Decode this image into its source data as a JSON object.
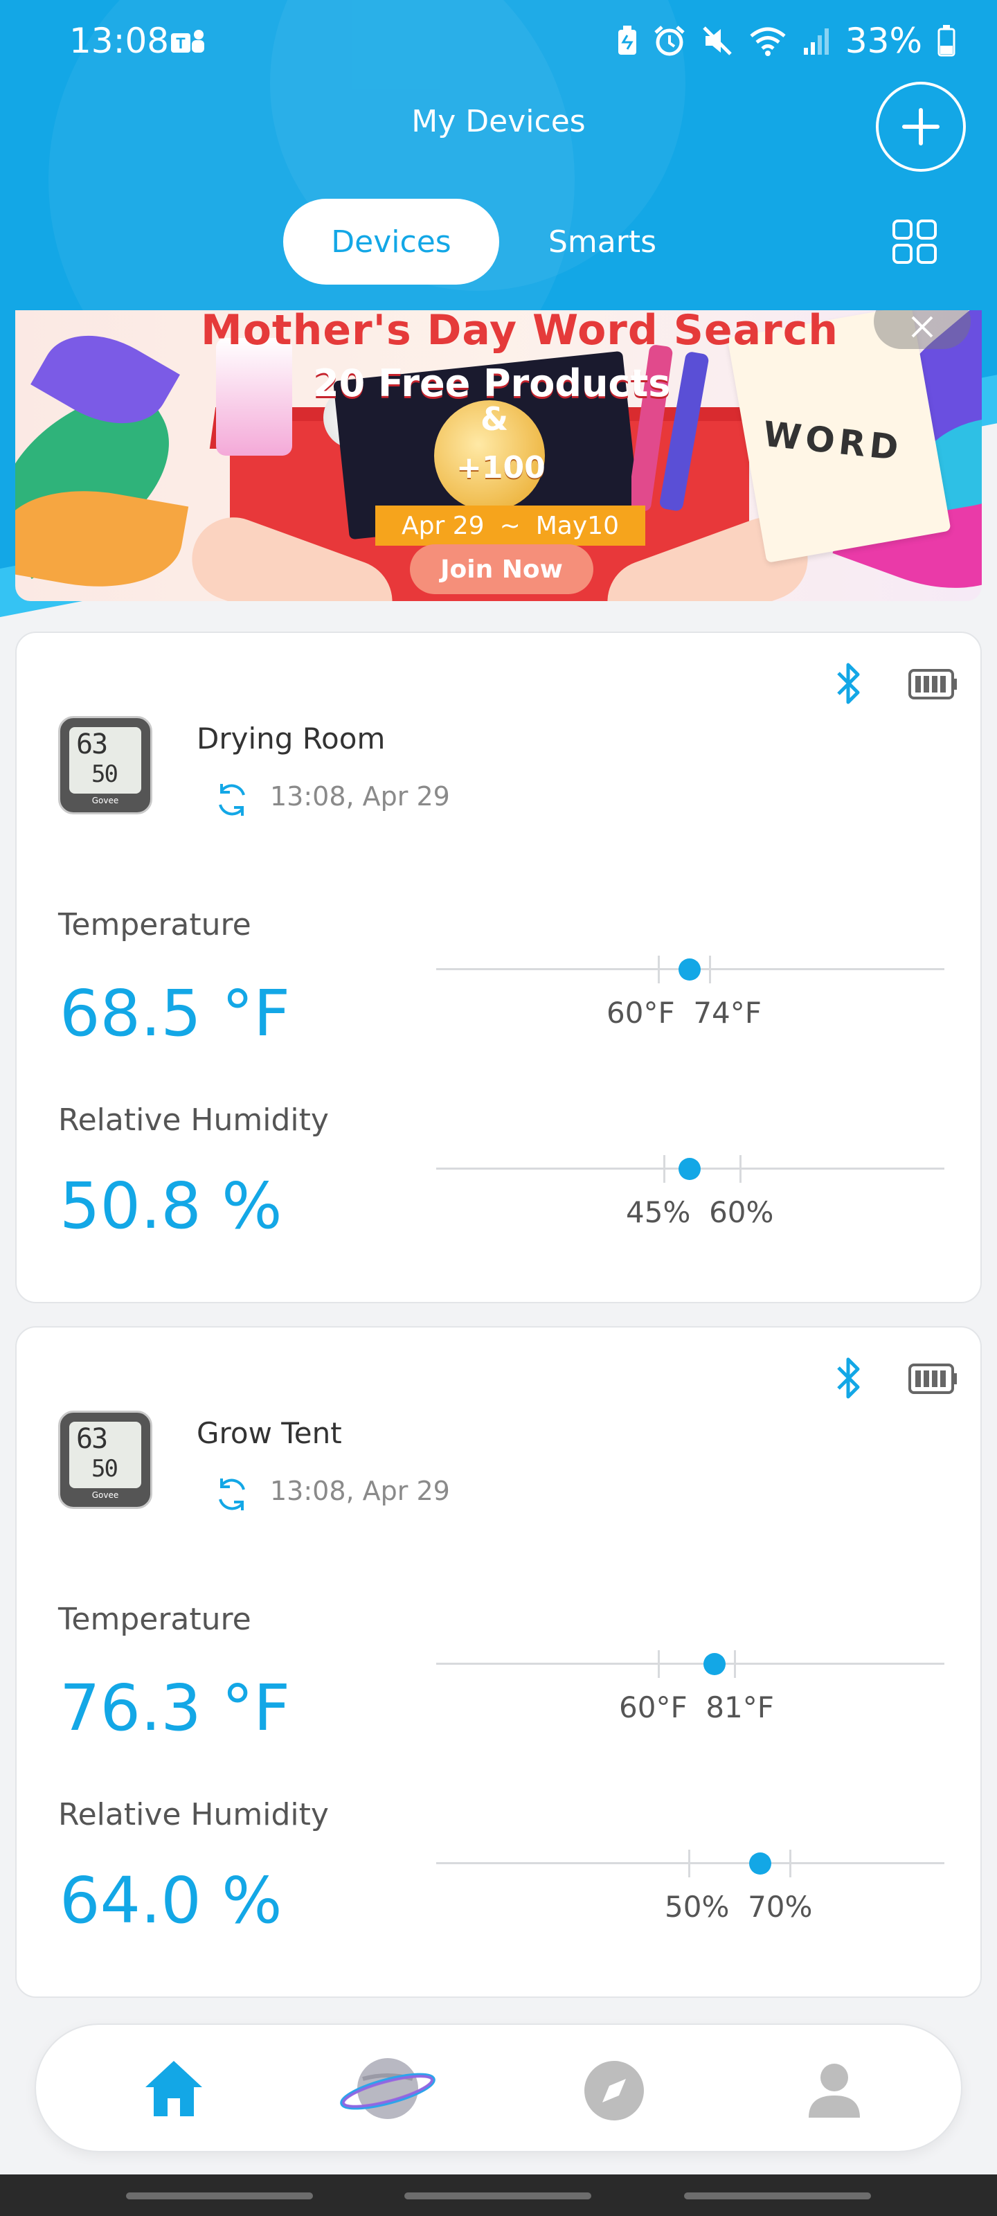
{
  "status_bar": {
    "time": "13:08",
    "battery_percent": "33%",
    "icons": [
      "teams-icon",
      "battery-saver-icon",
      "alarm-icon",
      "mute-icon",
      "wifi-icon",
      "signal-icon",
      "battery-icon"
    ]
  },
  "header": {
    "title": "My Devices",
    "add_icon": "plus-icon",
    "tabs": [
      {
        "label": "Devices",
        "active": true
      },
      {
        "label": "Smarts",
        "active": false
      }
    ],
    "layout_icon": "grid-icon"
  },
  "banner": {
    "title": "Mother's Day Word Search",
    "subtitle": "20 Free Products",
    "ampersand": "&",
    "bonus": "+100",
    "date_start": "Apr 29",
    "date_sep": "~",
    "date_end": "May10",
    "cta": "Join Now",
    "puzzle_word": "WORD",
    "close_icon": "close-icon"
  },
  "devices": [
    {
      "name": "Drying Room",
      "updated": "13:08,  Apr 29",
      "thumb_temp": "63",
      "thumb_hum": "50",
      "thumb_brand": "Govee",
      "temperature": {
        "label": "Temperature",
        "value": "68.5 °F",
        "reading": 68.5,
        "low": "60°F",
        "high": "74°F"
      },
      "humidity": {
        "label": "Relative Humidity",
        "value": "50.8 %",
        "reading": 50.8,
        "low": "45%",
        "high": "60%"
      }
    },
    {
      "name": "Grow Tent",
      "updated": "13:08,  Apr 29",
      "thumb_temp": "63",
      "thumb_hum": "50",
      "thumb_brand": "Govee",
      "temperature": {
        "label": "Temperature",
        "value": "76.3 °F",
        "reading": 76.3,
        "low": "60°F",
        "high": "81°F"
      },
      "humidity": {
        "label": "Relative Humidity",
        "value": "64.0 %",
        "reading": 64.0,
        "low": "50%",
        "high": "70%"
      }
    }
  ],
  "bottom_nav": {
    "items": [
      "home-icon",
      "planet-icon",
      "compass-icon",
      "profile-icon"
    ],
    "active": "home-icon"
  },
  "colors": {
    "accent": "#13a7e6",
    "header_bg": "#13a7e6",
    "card_bg": "#ffffff",
    "inactive_icon": "#bdbdbd"
  }
}
